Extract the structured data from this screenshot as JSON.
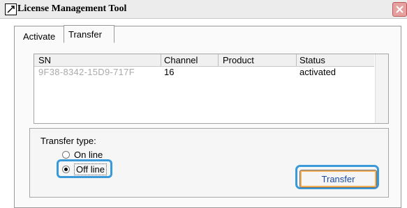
{
  "window": {
    "title": "License Management Tool"
  },
  "tabs": [
    {
      "label": "Activate"
    },
    {
      "label": "Transfer"
    }
  ],
  "list": {
    "columns": [
      "SN",
      "Channel",
      "Product",
      "Status"
    ],
    "rows": [
      {
        "sn": "9F38-8342-15D9-717F",
        "channel": "16",
        "product": "",
        "status": "activated"
      }
    ]
  },
  "transfer": {
    "group_label": "Transfer type:",
    "options": [
      {
        "label": "On line",
        "selected": false
      },
      {
        "label": "Off line",
        "selected": true
      }
    ],
    "button_label": "Transfer"
  },
  "colors": {
    "highlight": "#3a9ad9",
    "button_text": "#1b4ba3",
    "button_accent": "#f1b25b"
  }
}
